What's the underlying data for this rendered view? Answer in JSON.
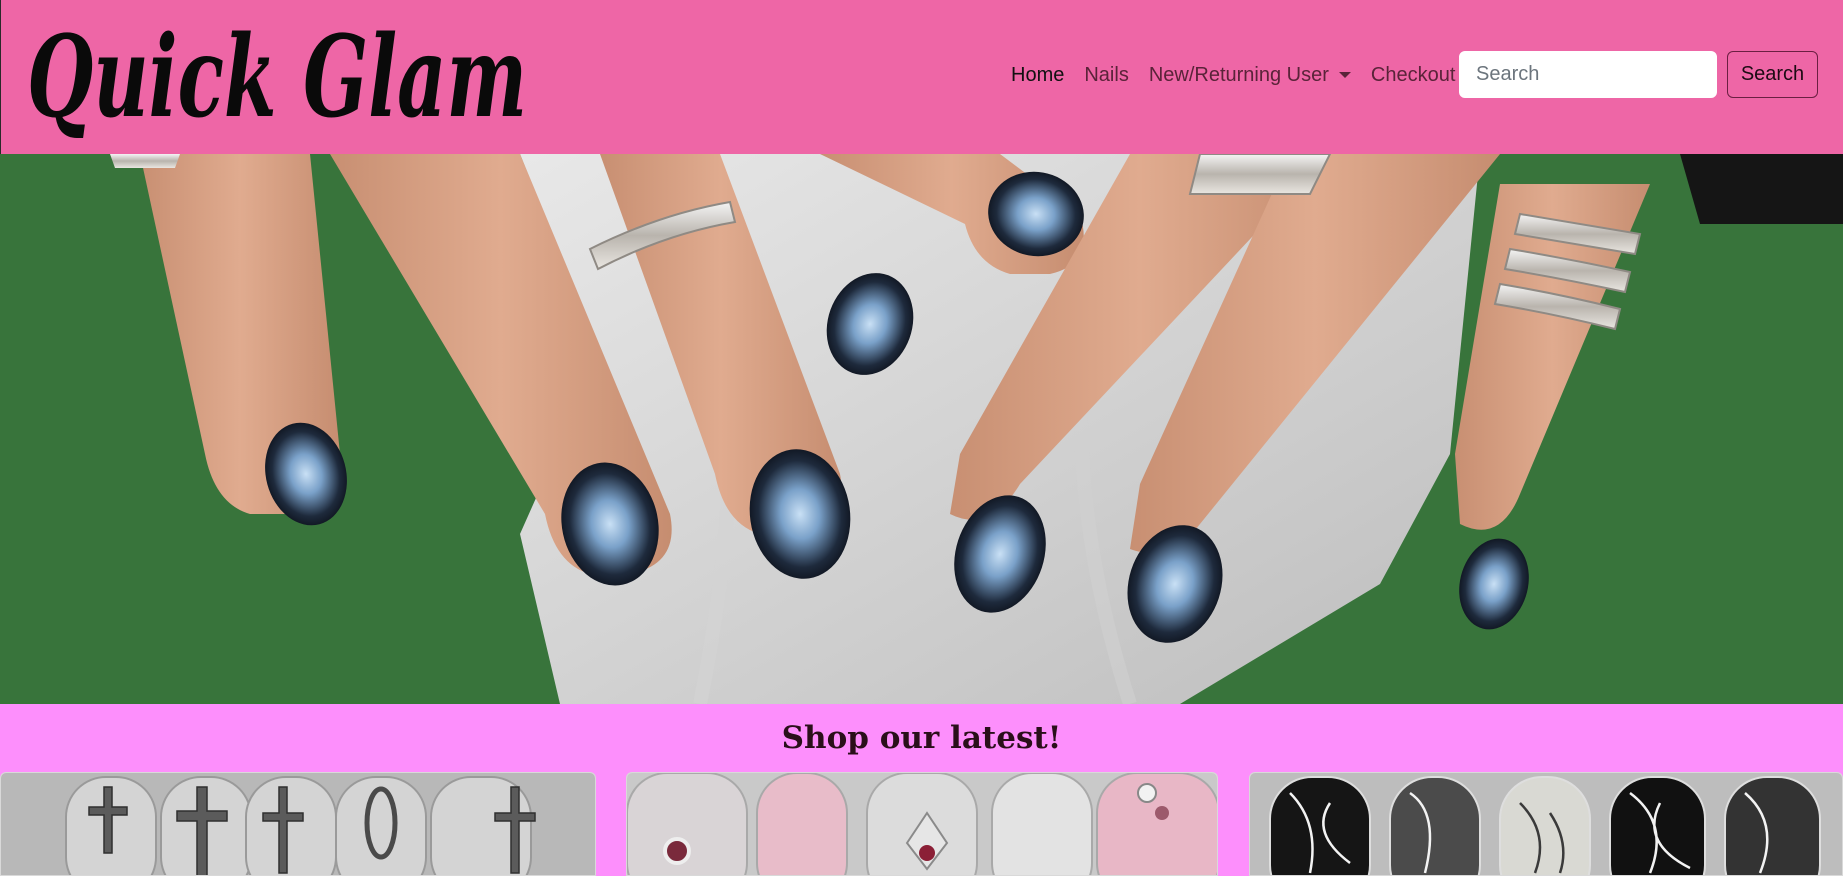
{
  "brand": {
    "name": "Quick Glam"
  },
  "nav": {
    "items": [
      {
        "label": "Home",
        "active": true
      },
      {
        "label": "Nails",
        "active": false
      },
      {
        "label": "New/Returning User",
        "dropdown": true
      },
      {
        "label": "Checkout",
        "active": false
      }
    ]
  },
  "search": {
    "placeholder": "Search",
    "value": "",
    "button_label": "Search"
  },
  "hero": {
    "image": "hero-nails-photo"
  },
  "shop": {
    "title": "Shop our latest!"
  },
  "products": [
    {
      "image": "chrome-cross-nails"
    },
    {
      "image": "pink-chrome-nails"
    },
    {
      "image": "black-marble-nails"
    }
  ],
  "colors": {
    "navbar": "#ee66a6",
    "band": "#fd8ffc",
    "hero_background": "#3e7a40"
  }
}
